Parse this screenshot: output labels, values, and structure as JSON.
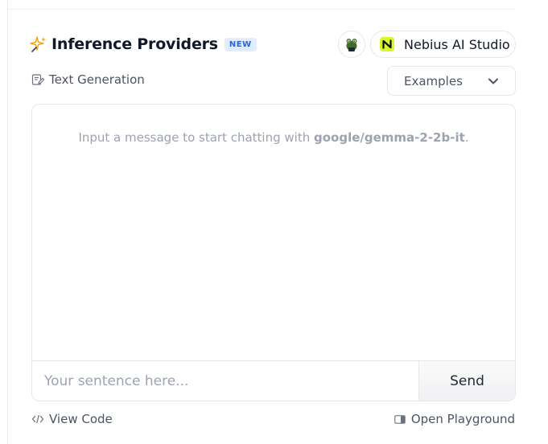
{
  "header": {
    "title": "Inference Providers",
    "badge": "NEW",
    "provider": {
      "label": "Nebius AI Studio",
      "logo_letter": "N",
      "logo_color": "#d9f82c"
    }
  },
  "task": {
    "label": "Text Generation"
  },
  "examples": {
    "label": "Examples"
  },
  "chat": {
    "placeholder_prefix": "Input a message to start chatting with ",
    "model": "google/gemma-2-2b-it",
    "placeholder_suffix": ".",
    "input_placeholder": "Your sentence here...",
    "send_label": "Send"
  },
  "footer": {
    "view_code": "View Code",
    "open_playground": "Open Playground"
  },
  "colors": {
    "badge_text": "#2563eb",
    "badge_bg": "#e0ecff",
    "sparkle": "#f59e0b"
  },
  "icons": [
    "sparkle-icon",
    "frog-avatar-icon",
    "nebius-logo-icon",
    "text-generation-icon",
    "chevron-down-icon",
    "code-icon",
    "panel-icon"
  ]
}
